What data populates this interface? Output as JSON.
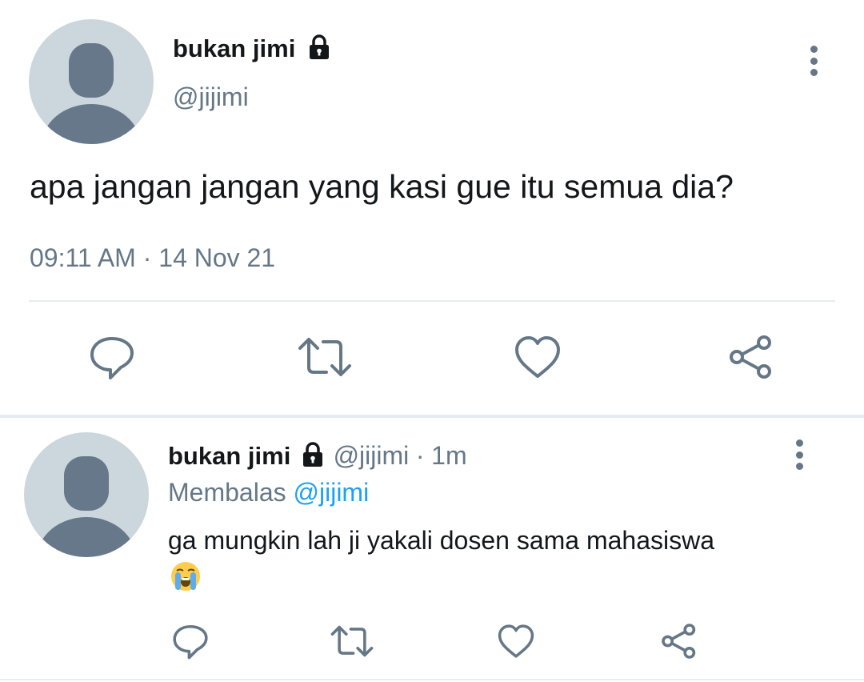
{
  "main_tweet": {
    "display_name": "bukan jimi",
    "handle": "@jijimi",
    "text": "apa jangan jangan yang kasi gue itu semua dia?",
    "time": "09:11 AM",
    "separator": "·",
    "date": "14 Nov 21"
  },
  "reply_tweet": {
    "display_name": "bukan jimi",
    "handle": "@jijimi",
    "separator": "·",
    "age": "1m",
    "replying_prefix": "Membalas",
    "replying_to": "@jijimi",
    "text": "ga mungkin lah ji yakali dosen sama mahasiswa"
  },
  "icons": {
    "avatar": "default-avatar-icon",
    "lock": "lock-icon",
    "more": "more-vertical-icon",
    "reply": "reply-icon",
    "retweet": "retweet-icon",
    "like": "heart-icon",
    "share": "share-icon",
    "emoji": "loudly-crying-face-emoji"
  },
  "colors": {
    "text": "#14171a",
    "muted": "#657786",
    "link": "#1da1f2",
    "divider": "#e6ecf0",
    "avatar_bg": "#ccd6dd",
    "avatar_fg": "#66788a"
  }
}
